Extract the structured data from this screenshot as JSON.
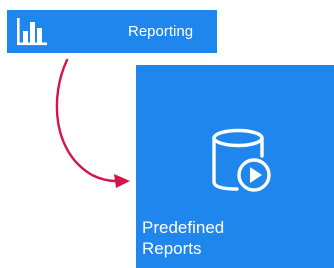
{
  "menu": {
    "label": "Reporting",
    "icon": "bar-chart-icon"
  },
  "tile": {
    "label_line1": "Predefined",
    "label_line2": "Reports",
    "icon": "database-play-icon"
  },
  "annotation": {
    "arrow_icon": "curved-arrow-icon"
  },
  "colors": {
    "tile_blue": "#1f86ed",
    "arrow": "#d4144a",
    "text": "#ffffff"
  }
}
